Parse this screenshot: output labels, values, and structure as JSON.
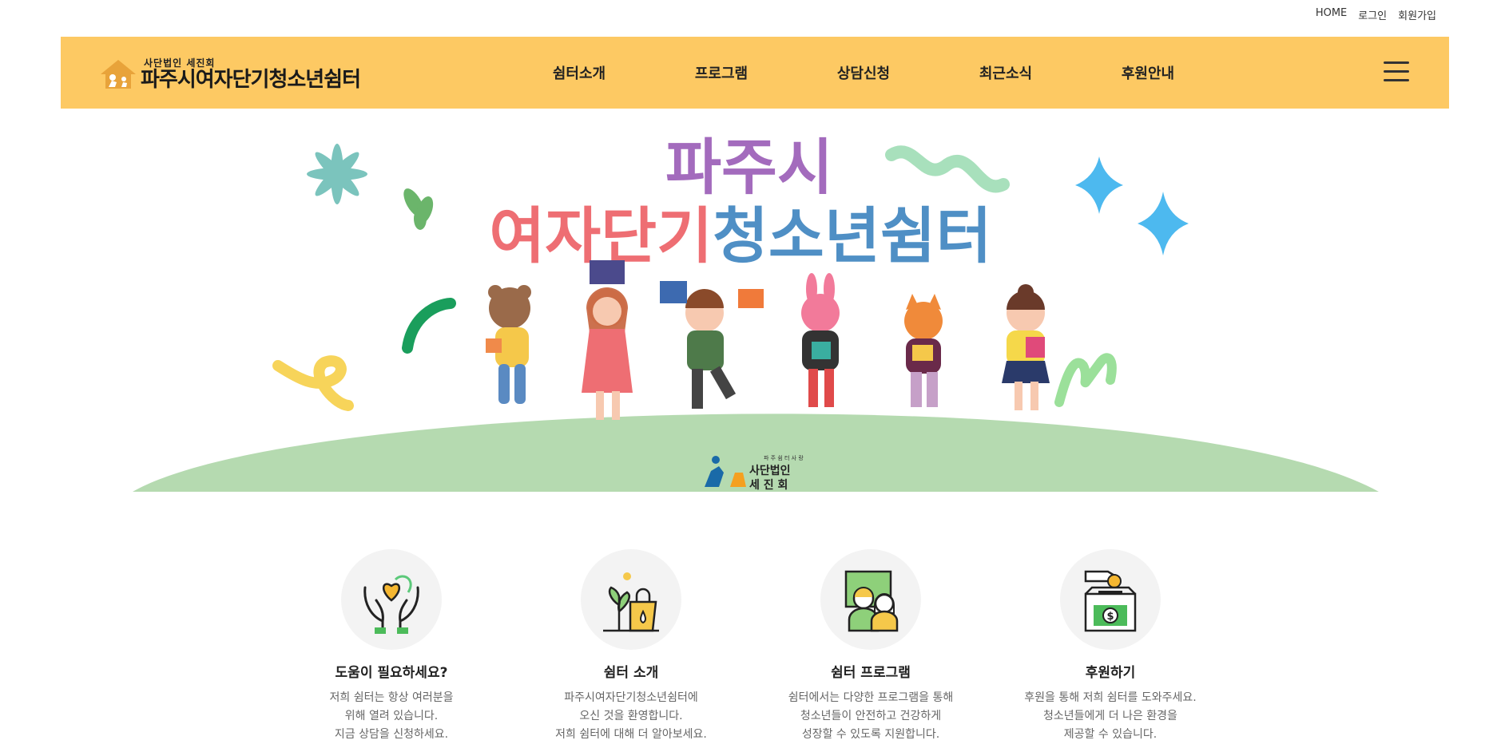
{
  "util_links": [
    "HOME",
    "로그인",
    "회원가입"
  ],
  "logo": {
    "sub": "사단법인 세진회",
    "main": "파주시여자단기청소년쉼터"
  },
  "nav": [
    "쉼터소개",
    "프로그램",
    "상담신청",
    "최근소식",
    "후원안내"
  ],
  "hero": {
    "title_line1": "파주시",
    "title_line2_part1": "여자단기",
    "title_line2_part2": "청소년쉼터",
    "badge_small": "파 주 쉼 터 사 랑",
    "badge_line1": "사단법인",
    "badge_line2": "세 진 회",
    "colors": {
      "purple": "#a36bbd",
      "coral": "#ee6e73",
      "blue": "#4f8fc5",
      "grass": "#b5dab0"
    }
  },
  "features": [
    {
      "icon": "heart-hands-icon",
      "title": "도움이 필요하세요?",
      "lines": [
        "저희 쉼터는 항상 여러분을",
        "위해 열려 있습니다.",
        "지금 상담을 신청하세요."
      ]
    },
    {
      "icon": "plant-bag-icon",
      "title": "쉼터 소개",
      "lines": [
        "파주시여자단기청소년쉼터에",
        "오신 것을 환영합니다.",
        "저희 쉼터에 대해 더 알아보세요."
      ]
    },
    {
      "icon": "people-icon",
      "title": "쉼터 프로그램",
      "lines": [
        "쉼터에서는 다양한 프로그램을 통해",
        "청소년들이 안전하고 건강하게",
        "성장할 수 있도록 지원합니다."
      ]
    },
    {
      "icon": "donation-box-icon",
      "title": "후원하기",
      "lines": [
        "후원을 통해 저희 쉼터를 도와주세요.",
        "청소년들에게 더 나은 환경을",
        "제공할 수 있습니다."
      ]
    }
  ]
}
